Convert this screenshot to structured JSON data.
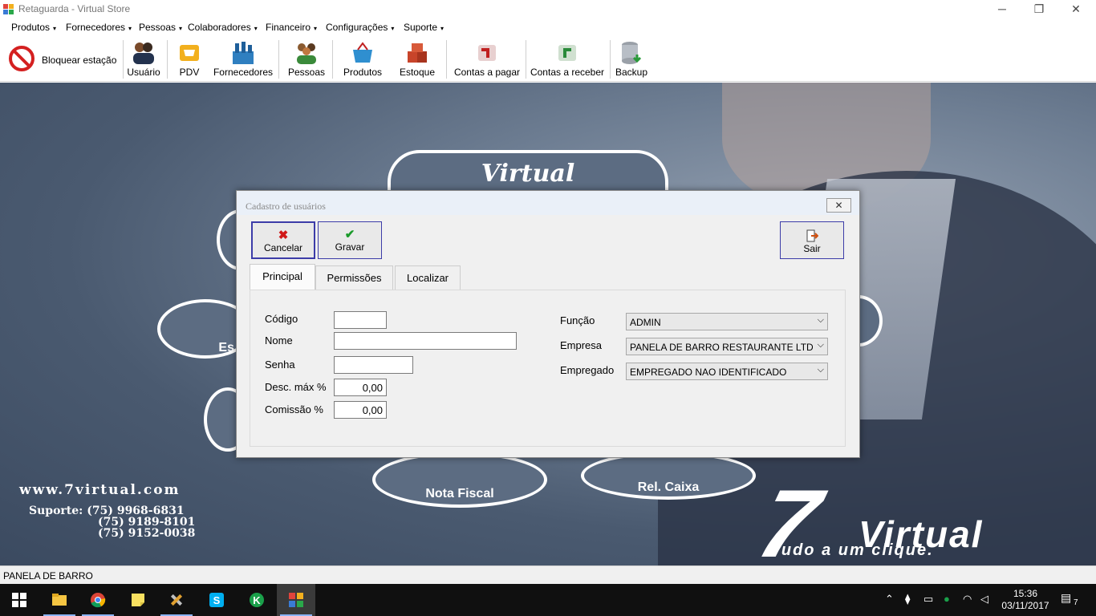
{
  "window": {
    "title": "Retaguarda - Virtual Store",
    "controls": {
      "minimize": "─",
      "restore": "❐",
      "close": "✕"
    }
  },
  "menu": {
    "items": [
      {
        "label": "Produtos"
      },
      {
        "label": "Fornecedores"
      },
      {
        "label": "Pessoas"
      },
      {
        "label": "Colaboradores"
      },
      {
        "label": "Financeiro"
      },
      {
        "label": "Configurações"
      },
      {
        "label": "Suporte"
      }
    ],
    "arrow": "▾"
  },
  "toolbar": {
    "lock_label": "Bloquear estação",
    "buttons": [
      {
        "label": "Usuário",
        "icon": "users-icon"
      },
      {
        "label": "PDV",
        "icon": "cart-icon"
      },
      {
        "label": "Fornecedores",
        "icon": "factory-icon"
      },
      {
        "label": "Pessoas",
        "icon": "people-icon"
      },
      {
        "label": "Produtos",
        "icon": "basket-icon"
      },
      {
        "label": "Estoque",
        "icon": "boxes-icon"
      },
      {
        "label": "Contas a pagar",
        "icon": "pay-icon"
      },
      {
        "label": "Contas a receber",
        "icon": "receive-icon"
      },
      {
        "label": "Backup",
        "icon": "database-icon"
      }
    ]
  },
  "background": {
    "logo_word": "Virtual",
    "bubble_labels": {
      "estoque_partial": "Es",
      "nota_fiscal": "Nota Fiscal",
      "rel_caixa": "Rel. Caixa"
    },
    "website": "www.7virtual.com",
    "support_label": "Suporte:",
    "phones": [
      "(75) 9968-6831",
      "(75) 9189-8101",
      "(75) 9152-0038"
    ],
    "brand_seven": "7",
    "brand_virtual": "Virtual",
    "brand_tagline": "Tudo a um clique."
  },
  "dialog": {
    "title": "Cadastro de usuários",
    "close_glyph": "✕",
    "buttons": {
      "cancel": "Cancelar",
      "save": "Gravar",
      "exit": "Sair"
    },
    "tabs": [
      {
        "label": "Principal",
        "selected": true
      },
      {
        "label": "Permissões",
        "selected": false
      },
      {
        "label": "Localizar",
        "selected": false
      }
    ],
    "fields": {
      "codigo": {
        "label": "Código",
        "value": ""
      },
      "nome": {
        "label": "Nome",
        "value": ""
      },
      "senha": {
        "label": "Senha",
        "value": ""
      },
      "desc_max": {
        "label": "Desc. máx %",
        "value": "0,00"
      },
      "comissao": {
        "label": "Comissão %",
        "value": "0,00"
      },
      "funcao": {
        "label": "Função",
        "value": "ADMIN"
      },
      "empresa": {
        "label": "Empresa",
        "value": "PANELA DE BARRO RESTAURANTE LTDA"
      },
      "empregado": {
        "label": "Empregado",
        "value": "EMPREGADO NAO IDENTIFICADO"
      }
    }
  },
  "statusbar": {
    "text": "PANELA DE BARRO"
  },
  "taskbar": {
    "time": "15:36",
    "date": "03/11/2017",
    "notification_count": "7",
    "colors": {
      "bg": "#101010",
      "active": "#3a3a3a"
    }
  }
}
